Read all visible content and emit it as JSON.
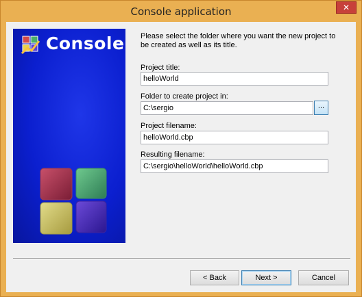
{
  "window": {
    "title": "Console application",
    "close_symbol": "✕"
  },
  "banner": {
    "title": "Console",
    "logo_icon": "codeblocks-logo-icon"
  },
  "intro_text": "Please select the folder where you want the new project to be created as well as its title.",
  "fields": {
    "project_title": {
      "label": "Project title:",
      "value": "helloWorld"
    },
    "folder": {
      "label": "Folder to create project in:",
      "value": "C:\\sergio",
      "browse_label": "..."
    },
    "project_filename": {
      "label": "Project filename:",
      "value": "helloWorld.cbp"
    },
    "resulting_filename": {
      "label": "Resulting filename:",
      "value": "C:\\sergio\\helloWorld\\helloWorld.cbp"
    }
  },
  "buttons": {
    "back": "< Back",
    "next": "Next >",
    "cancel": "Cancel"
  }
}
